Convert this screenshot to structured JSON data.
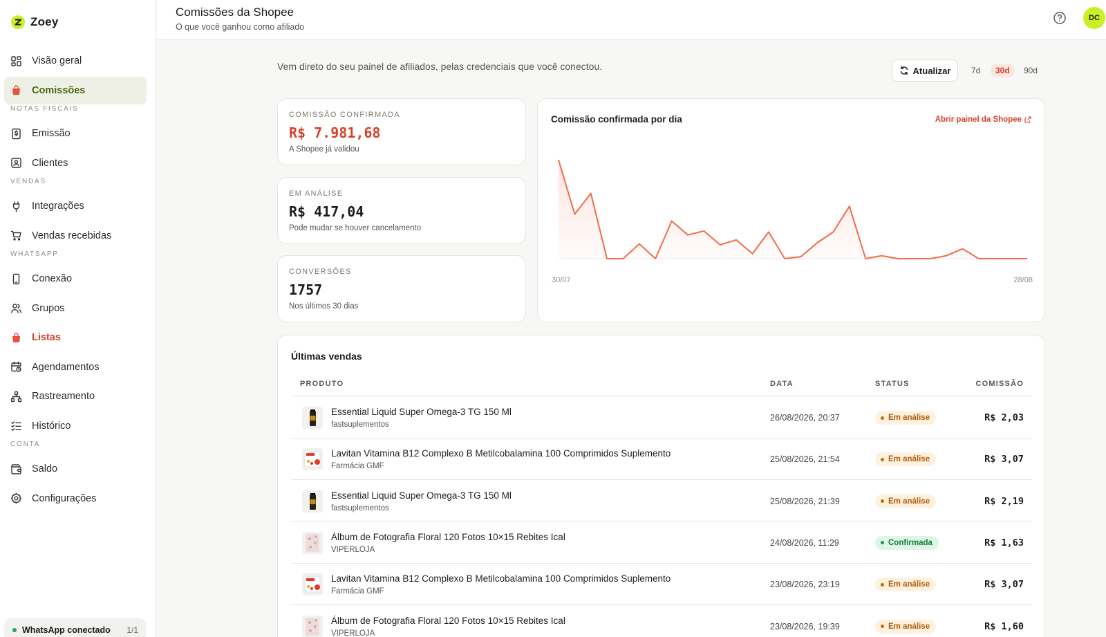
{
  "app": {
    "name": "Zoey"
  },
  "sidebar": {
    "items": [
      {
        "id": "visao-geral",
        "label": "Visão geral",
        "icon": "dashboard-icon"
      },
      {
        "id": "comissoes",
        "label": "Comissões",
        "icon": "shopping-bag-icon",
        "active": true
      },
      {
        "section": "NOTAS FISCAIS"
      },
      {
        "id": "emissao",
        "label": "Emissão",
        "icon": "dollar-document-icon"
      },
      {
        "id": "clientes",
        "label": "Clientes",
        "icon": "contact-card-icon"
      },
      {
        "section": "VENDAS"
      },
      {
        "id": "integracoes",
        "label": "Integrações",
        "icon": "plug-icon"
      },
      {
        "id": "vendas-recebidas",
        "label": "Vendas recebidas",
        "icon": "cart-icon"
      },
      {
        "section": "WHATSAPP"
      },
      {
        "id": "conexao",
        "label": "Conexão",
        "icon": "phone-icon"
      },
      {
        "id": "grupos",
        "label": "Grupos",
        "icon": "users-icon"
      },
      {
        "id": "listas",
        "label": "Listas",
        "icon": "shopping-bag-icon",
        "highlight": true
      },
      {
        "id": "agendamentos",
        "label": "Agendamentos",
        "icon": "calendar-clock-icon"
      },
      {
        "id": "rastreamento",
        "label": "Rastreamento",
        "icon": "network-icon"
      },
      {
        "id": "historico",
        "label": "Histórico",
        "icon": "checklist-icon"
      },
      {
        "section": "CONTA"
      },
      {
        "id": "saldo",
        "label": "Saldo",
        "icon": "wallet-icon"
      },
      {
        "id": "configuracoes",
        "label": "Configurações",
        "icon": "gear-icon"
      }
    ],
    "footer": {
      "label": "WhatsApp conectado",
      "count": "1/1"
    }
  },
  "header": {
    "title": "Comissões da Shopee",
    "subtitle": "O que você ganhou como afiliado",
    "avatar": "DC"
  },
  "main": {
    "intro": "Vem direto do seu painel de afiliados, pelas credenciais que você conectou.",
    "refresh_label": "Atualizar",
    "ranges": [
      "7d",
      "30d",
      "90d"
    ],
    "active_range": "30d",
    "kpis": [
      {
        "label": "COMISSÃO CONFIRMADA",
        "value": "R$ 7.981,68",
        "note": "A Shopee já validou"
      },
      {
        "label": "EM ANÁLISE",
        "value": "R$ 417,04",
        "note": "Pode mudar se houver cancelamento"
      },
      {
        "label": "CONVERSÕES",
        "value": "1757",
        "note": "Nos últimos 30 dias"
      }
    ],
    "chart": {
      "title": "Comissão confirmada por dia",
      "link_label": "Abrir painel da Shopee",
      "x_start": "30/07",
      "x_end": "28/08"
    },
    "table": {
      "title": "Últimas vendas",
      "headers": {
        "product": "PRODUTO",
        "date": "DATA",
        "status": "STATUS",
        "commission": "COMISSÃO"
      },
      "rows": [
        {
          "product": "Essential Liquid Super Omega-3 TG 150 Ml",
          "store": "fastsuplementos",
          "date": "26/08/2026, 20:37",
          "status": "Em análise",
          "amount": "R$ 2,03",
          "thumb": "omega"
        },
        {
          "product": "Lavitan Vitamina B12 Complexo B Metilcobalamina 100 Comprimidos Suplemento",
          "store": "Farmácia GMF",
          "date": "25/08/2026, 21:54",
          "status": "Em análise",
          "amount": "R$ 3,07",
          "thumb": "lavitan"
        },
        {
          "product": "Essential Liquid Super Omega-3 TG 150 Ml",
          "store": "fastsuplementos",
          "date": "25/08/2026, 21:39",
          "status": "Em análise",
          "amount": "R$ 2,19",
          "thumb": "omega"
        },
        {
          "product": "Álbum de Fotografia Floral 120 Fotos 10×15 Rebites Ical",
          "store": "VIPERLOJA",
          "date": "24/08/2026, 11:29",
          "status": "Confirmada",
          "amount": "R$ 1,63",
          "thumb": "album"
        },
        {
          "product": "Lavitan Vitamina B12 Complexo B Metilcobalamina 100 Comprimidos Suplemento",
          "store": "Farmácia GMF",
          "date": "23/08/2026, 23:19",
          "status": "Em análise",
          "amount": "R$ 3,07",
          "thumb": "lavitan"
        },
        {
          "product": "Álbum de Fotografia Floral 120 Fotos 10×15 Rebites Ical",
          "store": "VIPERLOJA",
          "date": "23/08/2026, 19:39",
          "status": "Em análise",
          "amount": "R$ 1,60",
          "thumb": "album"
        }
      ]
    }
  },
  "chart_data": {
    "type": "area",
    "title": "Comissão confirmada por dia",
    "x_tick_labels": [
      "30/07",
      "28/08"
    ],
    "x": [
      "30/07",
      "31/07",
      "01/08",
      "02/08",
      "03/08",
      "04/08",
      "05/08",
      "06/08",
      "07/08",
      "08/08",
      "09/08",
      "10/08",
      "11/08",
      "12/08",
      "13/08",
      "14/08",
      "15/08",
      "16/08",
      "17/08",
      "18/08",
      "19/08",
      "20/08",
      "21/08",
      "22/08",
      "23/08",
      "24/08",
      "25/08",
      "26/08",
      "27/08",
      "28/08"
    ],
    "series": [
      {
        "values": [
          1.0,
          0.45,
          0.66,
          0.0,
          0.0,
          0.15,
          0.0,
          0.38,
          0.24,
          0.28,
          0.14,
          0.19,
          0.05,
          0.27,
          0.0,
          0.02,
          0.16,
          0.27,
          0.53,
          0.0,
          0.03,
          0.0,
          0.0,
          0.0,
          0.03,
          0.1,
          0.0,
          0.0,
          0.0,
          0.0
        ]
      }
    ],
    "color": "#f26b4a",
    "grid": false
  },
  "colors": {
    "accent": "#d4412a",
    "brand": "#c8f024",
    "chart": "#f26b4a"
  }
}
